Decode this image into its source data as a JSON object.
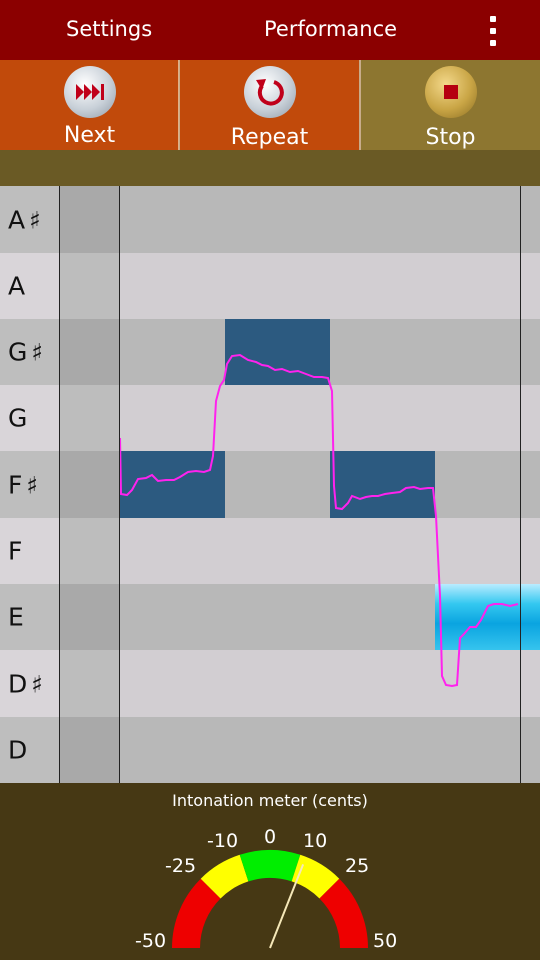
{
  "topbar": {
    "settings_label": "Settings",
    "performance_label": "Performance",
    "overflow_icon": "kebab-menu-icon",
    "color": "#8b0000"
  },
  "toolbar": {
    "next": {
      "label": "Next",
      "icon": "skip-next-icon",
      "color": "#c14a0b"
    },
    "repeat": {
      "label": "Repeat",
      "icon": "repeat-icon",
      "color": "#c14a0b"
    },
    "stop": {
      "label": "Stop",
      "icon": "stop-icon",
      "color": "#8d7630"
    }
  },
  "piano_roll": {
    "rows": [
      {
        "name": "A",
        "accidental": "♯"
      },
      {
        "name": "A",
        "accidental": ""
      },
      {
        "name": "G",
        "accidental": "♯"
      },
      {
        "name": "G",
        "accidental": ""
      },
      {
        "name": "F",
        "accidental": "♯"
      },
      {
        "name": "F",
        "accidental": ""
      },
      {
        "name": "E",
        "accidental": ""
      },
      {
        "name": "D",
        "accidental": "♯"
      },
      {
        "name": "D",
        "accidental": ""
      }
    ],
    "notes": [
      {
        "pitch": "F♯",
        "start": 0,
        "end": 1,
        "state": "played"
      },
      {
        "pitch": "G♯",
        "start": 1,
        "end": 2,
        "state": "played"
      },
      {
        "pitch": "F♯",
        "start": 2,
        "end": 3,
        "state": "played"
      },
      {
        "pitch": "E",
        "start": 3,
        "end": 4,
        "state": "current"
      }
    ],
    "pitch_trace_color": "#ff22ee",
    "note_color": "#2c5a80"
  },
  "intonation_meter": {
    "title": "Intonation meter (cents)",
    "ticks": [
      "-50",
      "-25",
      "-10",
      "0",
      "10",
      "25",
      "50"
    ],
    "needle_cents": 12,
    "zones": [
      {
        "from": -50,
        "to": -25,
        "color": "#ee0000"
      },
      {
        "from": -25,
        "to": -10,
        "color": "#ffff00"
      },
      {
        "from": -10,
        "to": 10,
        "color": "#00ee00"
      },
      {
        "from": 10,
        "to": 25,
        "color": "#ffff00"
      },
      {
        "from": 25,
        "to": 50,
        "color": "#ee0000"
      }
    ]
  }
}
